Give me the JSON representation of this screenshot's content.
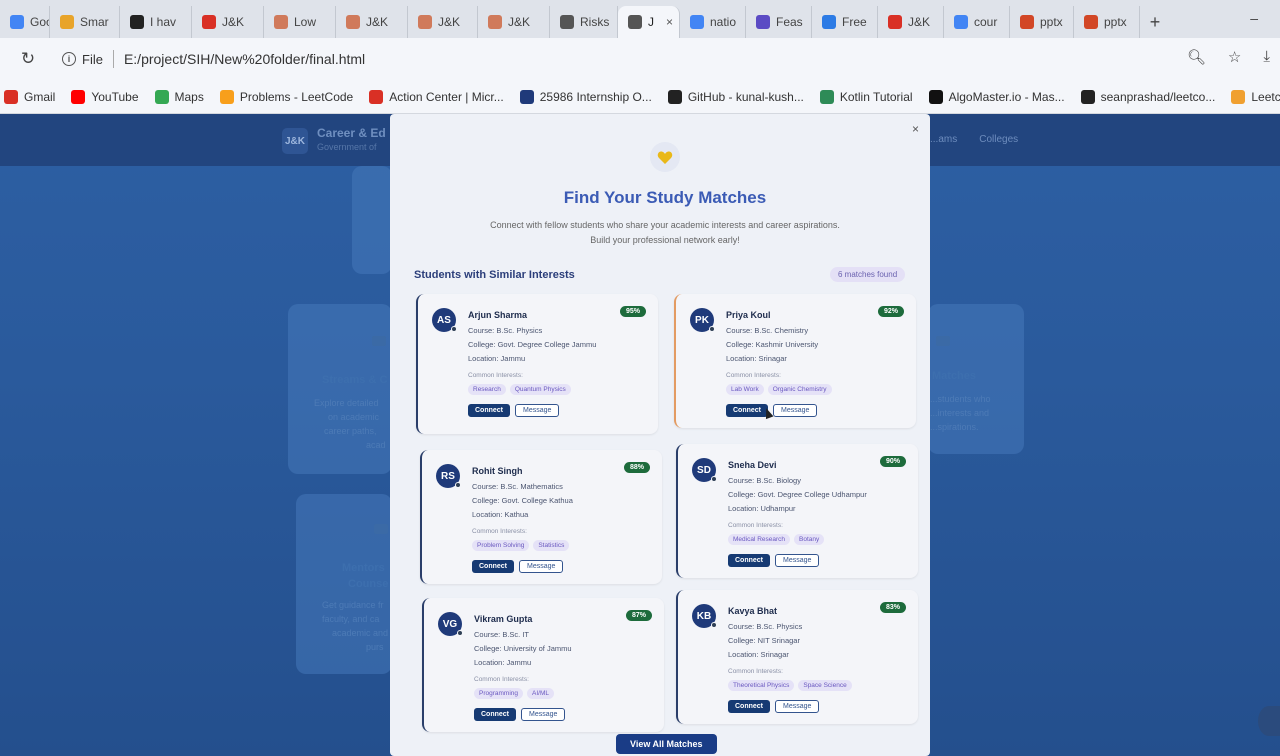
{
  "browser": {
    "tabs": [
      {
        "label": "Goog",
        "icon": "google-icon",
        "color": "#4285f4"
      },
      {
        "label": "Smar",
        "icon": "smart-icon",
        "color": "#e8a42a"
      },
      {
        "label": "I hav",
        "icon": "app-icon",
        "color": "#222222"
      },
      {
        "label": "J&K",
        "icon": "site-icon",
        "color": "#d93025"
      },
      {
        "label": "Low",
        "icon": "site-icon",
        "color": "#d07a5b"
      },
      {
        "label": "J&K",
        "icon": "site-icon",
        "color": "#d07a5b"
      },
      {
        "label": "J&K",
        "icon": "site-icon",
        "color": "#d07a5b"
      },
      {
        "label": "J&K",
        "icon": "site-icon",
        "color": "#d07a5b"
      },
      {
        "label": "Risks",
        "icon": "globe-icon",
        "color": "#555555"
      },
      {
        "label": "J",
        "icon": "globe-icon",
        "color": "#555555",
        "active": true
      },
      {
        "label": "natio",
        "icon": "google-icon",
        "color": "#4285f4"
      },
      {
        "label": "Feas",
        "icon": "site-icon",
        "color": "#5b4bc4"
      },
      {
        "label": "Free",
        "icon": "site-icon",
        "color": "#2c7be5"
      },
      {
        "label": "J&K",
        "icon": "site-icon",
        "color": "#d93025"
      },
      {
        "label": "cour",
        "icon": "google-icon",
        "color": "#4285f4"
      },
      {
        "label": "pptx",
        "icon": "ppt-icon",
        "color": "#d24726"
      },
      {
        "label": "pptx",
        "icon": "ppt-icon",
        "color": "#d24726"
      }
    ],
    "new_tab": "+",
    "minimize": "–",
    "scheme": "File",
    "url": "E:/project/SIH/New%20folder/final.html",
    "bookmarks": [
      {
        "label": "Gmail",
        "icon": "gmail-icon",
        "color": "#d93025"
      },
      {
        "label": "YouTube",
        "icon": "youtube-icon",
        "color": "#ff0000"
      },
      {
        "label": "Maps",
        "icon": "maps-icon",
        "color": "#34a853"
      },
      {
        "label": "Problems - LeetCode",
        "icon": "leetcode-icon",
        "color": "#f89f1b"
      },
      {
        "label": "Action Center | Micr...",
        "icon": "site-icon",
        "color": "#d93025"
      },
      {
        "label": "25986 Internship O...",
        "icon": "site-icon",
        "color": "#1f3a7a"
      },
      {
        "label": "GitHub - kunal-kush...",
        "icon": "github-icon",
        "color": "#222222"
      },
      {
        "label": "Kotlin Tutorial",
        "icon": "site-icon",
        "color": "#2e8b57"
      },
      {
        "label": "AlgoMaster.io - Mas...",
        "icon": "site-icon",
        "color": "#111111"
      },
      {
        "label": "seanprashad/leetco...",
        "icon": "github-icon",
        "color": "#222222"
      },
      {
        "label": "Leetcode Patterns",
        "icon": "site-icon",
        "color": "#f0a030"
      }
    ]
  },
  "site": {
    "logo": "J&K",
    "brand": "Career & Ed",
    "brand_sub": "Government of",
    "nav": [
      "...ams",
      "Colleges"
    ],
    "bg_cards": {
      "streams_title": "Streams & C",
      "streams_text": [
        "Explore detailed",
        "on academic",
        "career paths,",
        "acad"
      ],
      "matches_title": "Matches",
      "matches_text": [
        "...students who",
        "...interests and",
        "...spirations."
      ],
      "mentor_title": [
        "Mentors",
        "Counse"
      ],
      "mentor_text": [
        "Get guidance fr",
        "faculty, and ca",
        "academic and",
        "purs"
      ]
    }
  },
  "modal": {
    "close": "×",
    "title": "Find Your Study Matches",
    "description": [
      "Connect with fellow students who share your academic interests and career aspirations.",
      "Build your professional network early!"
    ],
    "section_title": "Students with Similar Interests",
    "match_count": "6 matches found",
    "interests_label": "Common Interests:",
    "connect_label": "Connect",
    "message_label": "Message",
    "view_all": "View All Matches",
    "students": [
      {
        "initials": "AS",
        "name": "Arjun Sharma",
        "match": "95%",
        "course": "Course: B.Sc. Physics",
        "college": "College: Govt. Degree College Jammu",
        "location": "Location: Jammu",
        "interests": [
          "Research",
          "Quantum Physics"
        ]
      },
      {
        "initials": "PK",
        "name": "Priya Koul",
        "match": "92%",
        "course": "Course: B.Sc. Chemistry",
        "college": "College: Kashmir University",
        "location": "Location: Srinagar",
        "interests": [
          "Lab Work",
          "Organic Chemistry"
        ]
      },
      {
        "initials": "RS",
        "name": "Rohit Singh",
        "match": "88%",
        "course": "Course: B.Sc. Mathematics",
        "college": "College: Govt. College Kathua",
        "location": "Location: Kathua",
        "interests": [
          "Problem Solving",
          "Statistics"
        ]
      },
      {
        "initials": "SD",
        "name": "Sneha Devi",
        "match": "90%",
        "course": "Course: B.Sc. Biology",
        "college": "College: Govt. Degree College Udhampur",
        "location": "Location: Udhampur",
        "interests": [
          "Medical Research",
          "Botany"
        ]
      },
      {
        "initials": "VG",
        "name": "Vikram Gupta",
        "match": "87%",
        "course": "Course: B.Sc. IT",
        "college": "College: University of Jammu",
        "location": "Location: Jammu",
        "interests": [
          "Programming",
          "AI/ML"
        ]
      },
      {
        "initials": "KB",
        "name": "Kavya Bhat",
        "match": "83%",
        "course": "Course: B.Sc. Physics",
        "college": "College: NIT Srinagar",
        "location": "Location: Srinagar",
        "interests": [
          "Theoretical Physics",
          "Space Science"
        ]
      }
    ]
  },
  "colors": {
    "accent": "#3b5bb5",
    "match_badge": "#1d6b3c",
    "connect_button": "#163a73",
    "tag_bg": "#e5e2f7",
    "tag_text": "#6a58c0"
  }
}
